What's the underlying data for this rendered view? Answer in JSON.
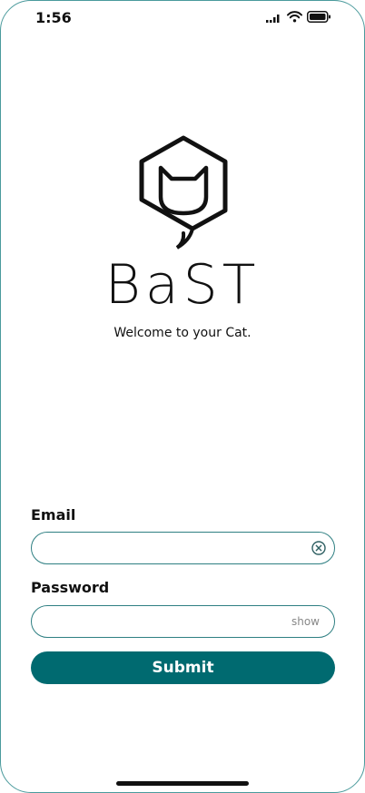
{
  "status_bar": {
    "time": "1:56"
  },
  "brand": {
    "name": "BaST",
    "tagline": "Welcome to your Cat."
  },
  "login_form": {
    "email_label": "Email",
    "email_value": "",
    "password_label": "Password",
    "password_value": "",
    "show_label": "show",
    "submit_label": "Submit"
  },
  "colors": {
    "accent": "#006a70",
    "field_border": "#2e7f82",
    "frame_border": "#4a9a9c"
  },
  "icons": {
    "logo": "cat-hexagon-logo",
    "clear": "clear-circle-x-icon",
    "signal": "cellular-signal-icon",
    "wifi": "wifi-icon",
    "battery": "battery-icon"
  }
}
